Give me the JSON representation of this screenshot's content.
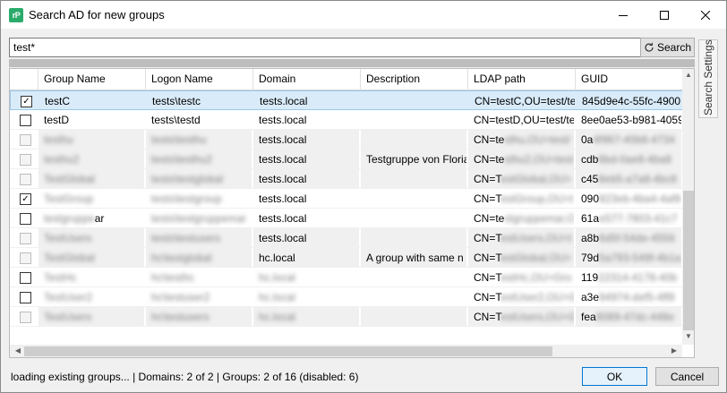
{
  "window": {
    "title": "Search AD for new groups",
    "app_icon": "rP"
  },
  "search": {
    "value": "test*",
    "button_label": "Search"
  },
  "progress": {
    "value": 1.0
  },
  "side_tab": {
    "label": "Search Settings"
  },
  "columns": [
    "Group Name",
    "Logon Name",
    "Domain",
    "Description",
    "LDAP path",
    "GUID"
  ],
  "rows": [
    {
      "checked": true,
      "disabled": false,
      "blurred": false,
      "selected": true,
      "name": "testC",
      "logon": "tests\\testc",
      "domain": "tests.local",
      "description": "",
      "ldap": "CN=testC,OU=test/te",
      "guid": "845d9e4c-55fc-4900"
    },
    {
      "checked": false,
      "disabled": false,
      "blurred": false,
      "selected": false,
      "name": "testD",
      "logon": "tests\\testd",
      "domain": "tests.local",
      "description": "",
      "ldap": "CN=testD,OU=test/te",
      "guid": "8ee0ae53-b981-4059"
    },
    {
      "checked": false,
      "disabled": true,
      "blurred": true,
      "selected": false,
      "name": "testhu",
      "logon": "tests\\testhu",
      "domain": "tests.local",
      "description": "",
      "ldap": "CN=te",
      "ldap_blur": "sthu,OU=test/",
      "guid": "0a",
      "guid_blur": "4f967-40b8-4734"
    },
    {
      "checked": false,
      "disabled": true,
      "blurred": true,
      "selected": false,
      "name": "testhu2",
      "logon": "tests\\testhu2",
      "domain": "tests.local",
      "description": "Testgruppe von Floria",
      "ldap": "CN=te",
      "ldap_blur": "sthu2,OU=test",
      "guid": "cdb",
      "guid_blur": "8bd-0ae8-4ba8"
    },
    {
      "checked": false,
      "disabled": true,
      "blurred": true,
      "selected": false,
      "name": "TestGlobal",
      "logon": "tests\\testglobal",
      "domain": "tests.local",
      "description": "",
      "ldap": "CN=T",
      "ldap_blur": "estGlobal,OU=",
      "guid": "c45",
      "guid_blur": "8eb5-a7a8-4bc8"
    },
    {
      "checked": true,
      "disabled": false,
      "blurred": true,
      "selected": false,
      "name": "TestGroup",
      "logon": "tests\\testgroup",
      "domain": "tests.local",
      "description": "",
      "ldap": "CN=T",
      "ldap_blur": "estGroup,OU=t",
      "guid": "090",
      "guid_blur": "823eb-4ba4-4af8"
    },
    {
      "checked": false,
      "disabled": false,
      "blurred": true,
      "selected": false,
      "name": "testgruppe",
      "name_suffix": "ar",
      "logon": "tests\\testgruppemar",
      "domain": "tests.local",
      "description": "",
      "ldap": "CN=te",
      "ldap_blur": "stgruppemar,O",
      "guid": "61a",
      "guid_blur": "e577-7803-41c7"
    },
    {
      "checked": false,
      "disabled": true,
      "blurred": true,
      "selected": false,
      "name": "TestUsers",
      "logon": "tests\\testusers",
      "domain": "tests.local",
      "description": "",
      "ldap": "CN=T",
      "ldap_blur": "estUsers,OU=t",
      "guid": "a8b",
      "guid_blur": "6d5f-54de-4556"
    },
    {
      "checked": false,
      "disabled": true,
      "blurred": true,
      "selected": false,
      "name": "TestGlobal",
      "logon": "hc\\testglobal",
      "domain": "hc.local",
      "description": "A group with same n",
      "ldap": "CN=T",
      "ldap_blur": "estGlobal,OU=",
      "guid": "79d",
      "guid_blur": "5a793-549f-4b1a"
    },
    {
      "checked": false,
      "disabled": false,
      "blurred": true,
      "selected": false,
      "name": "TestHc",
      "logon": "hc\\testhc",
      "domain": "hc.local",
      "description": "",
      "ldap": "CN=T",
      "ldap_blur": "estHc,OU=Gro",
      "guid": "119",
      "guid_blur": "22314-4178-40b",
      "domain_blur": true
    },
    {
      "checked": false,
      "disabled": false,
      "blurred": true,
      "selected": false,
      "name": "TestUser2",
      "logon": "hc\\testuser2",
      "domain": "hc.local",
      "description": "",
      "ldap": "CN=T",
      "ldap_blur": "estUser2,OU=G",
      "guid": "a3e",
      "guid_blur": "94974-def5-4ff8",
      "domain_blur": true
    },
    {
      "checked": false,
      "disabled": true,
      "blurred": true,
      "selected": false,
      "name": "TestUsers",
      "logon": "hc\\testusers",
      "domain": "hc.local",
      "description": "",
      "ldap": "CN=T",
      "ldap_blur": "estUsers,OU=G",
      "guid": "fea",
      "guid_blur": "8089-47dc-448e",
      "domain_blur": true
    }
  ],
  "status_text": "loading existing groups... | Domains: 2 of 2 | Groups: 2 of 16 (disabled: 6)",
  "buttons": {
    "ok": "OK",
    "cancel": "Cancel"
  }
}
